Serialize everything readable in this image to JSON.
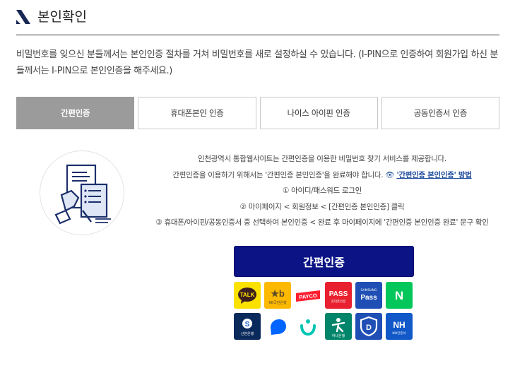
{
  "header": {
    "title": "본인확인"
  },
  "description": "비밀번호를 잊으신 분들께서는 본인인증 절차를 거쳐 비밀번호를 새로 설정하실 수 있습니다. (I-PIN으로 인증하여 회원가입 하신 분들께서는 I-PIN으로 본인인증을 해주세요.)",
  "tabs": [
    {
      "label": "간편인증",
      "active": true
    },
    {
      "label": "휴대폰본인 인증",
      "active": false
    },
    {
      "label": "나이스 아이핀 인증",
      "active": false
    },
    {
      "label": "공동인증서 인증",
      "active": false
    }
  ],
  "info": {
    "line1": "인천광역시 통합웹사이트는 간편인증을 이용한 비밀번호 찾기 서비스를 제공합니다.",
    "line2_prefix": "간편인증을 이용하기 위해서는 '간편인증 본인인증'을 완료해야 합니다.",
    "line2_eye": "👁",
    "line2_link": "'간편인증 본인인증' 방법",
    "step1": "① 아이디/패스워드 로그인",
    "step2": "② 마이페이지 < 회원정보 < [간편인증 본인인증] 클릭",
    "step3": "③ 휴대폰/아이핀/공동인증서 중 선택하여 본인인증 < 완료 후 마이페이지에 '간편인증 본인인증 완료' 문구 확인"
  },
  "easy_auth_button": "간편인증",
  "apps": {
    "kakao": {
      "label": "TALK",
      "color": "#fae100"
    },
    "kb": {
      "label": "★b",
      "sub": "KB국민은행",
      "color": "#fcb900"
    },
    "payco": {
      "label": "PAYCO",
      "color": "#ffffff",
      "accent": "#ff1f2f"
    },
    "pass_sk": {
      "label": "PASS",
      "sub": "휴대폰인증",
      "color": "#e8202f"
    },
    "samsung_pass": {
      "label": "Pass",
      "sub": "SAMSUNG",
      "color": "#1f4fb5"
    },
    "naver": {
      "label": "N",
      "color": "#03c75a"
    },
    "shinhan": {
      "label": "S",
      "sub": "신한은행",
      "color": "#0b2a5c"
    },
    "toss": {
      "label": "toss",
      "color": "#ffffff",
      "accent": "#0064ff"
    },
    "banksalad": {
      "label": "bs",
      "color": "#ffffff",
      "accent": "#04c6b4"
    },
    "hana": {
      "label": "하나",
      "sub": "하나은행",
      "color": "#00856a"
    },
    "d_cert": {
      "label": "D",
      "color": "#1f4fb5"
    },
    "nh": {
      "label": "NH",
      "sub": "NH인증서",
      "color": "#1158c8"
    }
  }
}
